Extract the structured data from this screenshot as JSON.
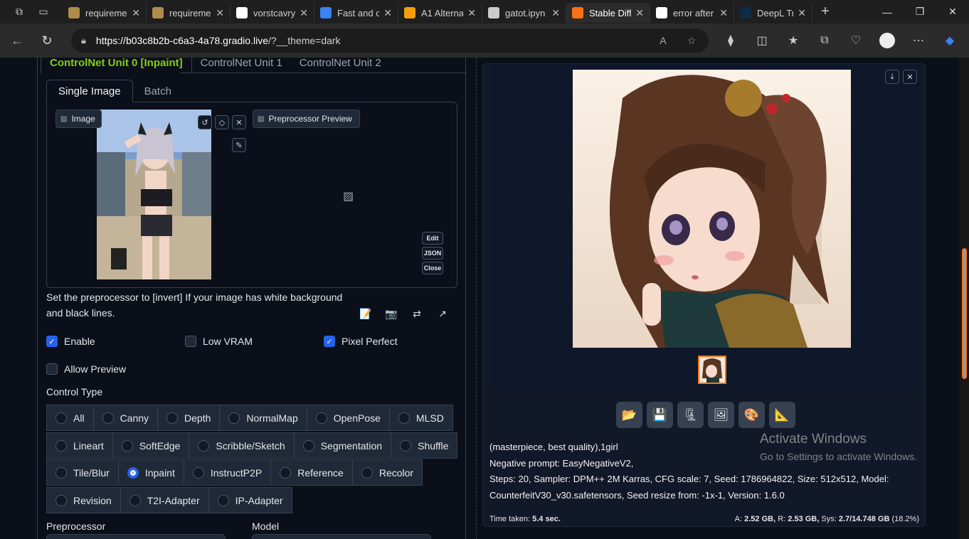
{
  "browser": {
    "tabs": [
      {
        "label": "requireme",
        "icon": "lock-folder-icon",
        "color": "#b08c4a"
      },
      {
        "label": "requireme",
        "icon": "lock-folder-icon",
        "color": "#b08c4a"
      },
      {
        "label": "vorstcavry",
        "icon": "github-icon",
        "color": "#ffffff"
      },
      {
        "label": "Fast and c",
        "icon": "settings-icon",
        "color": "#3b82f6"
      },
      {
        "label": "A1 Alterna",
        "icon": "colab-icon",
        "color": "#f59e0b"
      },
      {
        "label": "gatot.ipyn",
        "icon": "colab-icon",
        "color": "#cccccc"
      },
      {
        "label": "Stable Diff",
        "icon": "stable-diffusion-icon",
        "color": "#f97316"
      },
      {
        "label": "error after",
        "icon": "github-icon",
        "color": "#ffffff"
      },
      {
        "label": "DeepL Tra",
        "icon": "deepl-icon",
        "color": "#0f2b46"
      }
    ],
    "active_tab_index": 6,
    "url_host": "https://b03c8b2b-c6a3-4a78.gradio.live",
    "url_path": "/?__theme=dark"
  },
  "controlnet": {
    "unit_tabs": [
      "ControlNet Unit 0 [Inpaint]",
      "ControlNet Unit 1",
      "ControlNet Unit 2"
    ],
    "image_tabs": [
      "Single Image",
      "Batch"
    ],
    "image_label": "Image",
    "preprocessor_preview_label": "Preprocessor Preview",
    "side_buttons": [
      "Edit",
      "JSON",
      "Close"
    ],
    "hint": "Set the preprocessor to [invert] If your image has white background and black lines.",
    "checkboxes": {
      "enable": {
        "label": "Enable",
        "checked": true
      },
      "low_vram": {
        "label": "Low VRAM",
        "checked": false
      },
      "pixel_perfect": {
        "label": "Pixel Perfect",
        "checked": true
      },
      "allow_preview": {
        "label": "Allow Preview",
        "checked": false
      }
    },
    "control_type_label": "Control Type",
    "control_types": [
      [
        "All",
        "Canny",
        "Depth",
        "NormalMap",
        "OpenPose",
        "MLSD"
      ],
      [
        "Lineart",
        "SoftEdge",
        "Scribble/Sketch",
        "Segmentation",
        "Shuffle"
      ],
      [
        "Tile/Blur",
        "Inpaint",
        "InstructP2P",
        "Reference",
        "Recolor"
      ],
      [
        "Revision",
        "T2I-Adapter",
        "IP-Adapter"
      ]
    ],
    "selected_control_type": "Inpaint",
    "preprocessor_label": "Preprocessor",
    "model_label": "Model"
  },
  "output": {
    "action_icons": [
      "folder-icon",
      "save-icon",
      "zip-icon",
      "image-icon",
      "palette-icon",
      "ruler-icon"
    ],
    "info_line1": "(masterpiece, best quality),1girl",
    "info_line2": "Negative prompt: EasyNegativeV2,",
    "info_line3": "Steps: 20, Sampler: DPM++ 2M Karras, CFG scale: 7, Seed: 1786964822, Size: 512x512, Model:",
    "info_line4": "CounterfeitV30_v30.safetensors, Seed resize from: -1x-1, Version: 1.6.0",
    "time_label": "Time taken:",
    "time_value": "5.4 sec.",
    "vram_a_label": "A:",
    "vram_a": "2.52 GB,",
    "vram_r_label": "R:",
    "vram_r": "2.53 GB,",
    "vram_sys_label": "Sys:",
    "vram_sys": "2.7/14.748 GB",
    "vram_pct": "(18.2%)"
  },
  "watermark": {
    "line1": "Activate Windows",
    "line2": "Go to Settings to activate Windows."
  }
}
